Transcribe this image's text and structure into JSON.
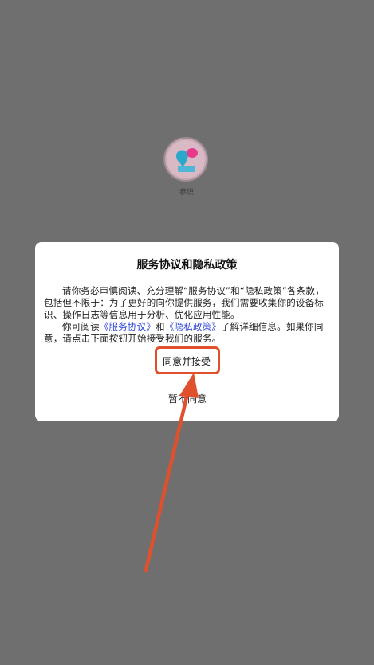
{
  "app": {
    "name": "参识"
  },
  "dialog": {
    "title": "服务协议和隐私政策",
    "para1": "请你务必审慎阅读、充分理解“服务协议”和“隐私政策”各条款，包括但不限于：为了更好的向你提供服务，我们需要收集你的设备标识、操作日志等信息用于分析、优化应用性能。",
    "para2_prefix": "你可阅读",
    "service_link": "《服务协议》",
    "para2_and": "和",
    "privacy_link": "《隐私政策》",
    "para2_suffix": "了解详细信息。如果你同意，请点击下面按钮开始接受我们的服务。",
    "agree_label": "同意并接受",
    "decline_label": "暂不同意"
  },
  "annotation": {
    "color": "#e0502d"
  }
}
